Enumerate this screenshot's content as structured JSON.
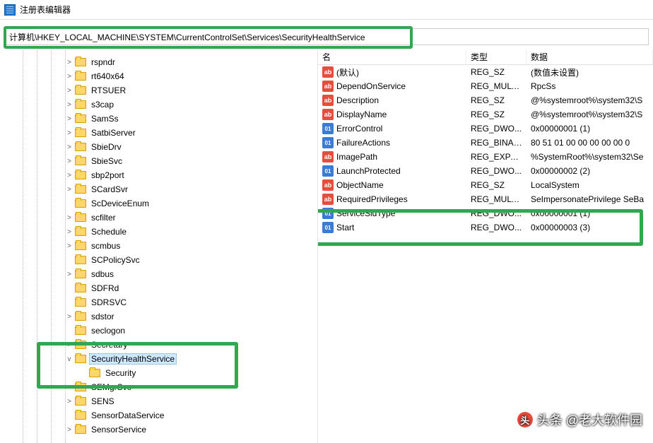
{
  "title": "注册表编辑器",
  "address": "计算机\\HKEY_LOCAL_MACHINE\\SYSTEM\\CurrentControlSet\\Services\\SecurityHealthService",
  "columns": {
    "name": "名",
    "type": "类型",
    "data": "数据"
  },
  "tree": [
    {
      "label": "rspndr",
      "indent": 92,
      "toggle": ">"
    },
    {
      "label": "rt640x64",
      "indent": 92,
      "toggle": ">"
    },
    {
      "label": "RTSUER",
      "indent": 92,
      "toggle": ">"
    },
    {
      "label": "s3cap",
      "indent": 92,
      "toggle": ">"
    },
    {
      "label": "SamSs",
      "indent": 92,
      "toggle": ">"
    },
    {
      "label": "SatbiServer",
      "indent": 92,
      "toggle": ">"
    },
    {
      "label": "SbieDrv",
      "indent": 92,
      "toggle": ">"
    },
    {
      "label": "SbieSvc",
      "indent": 92,
      "toggle": ">"
    },
    {
      "label": "sbp2port",
      "indent": 92,
      "toggle": ">"
    },
    {
      "label": "SCardSvr",
      "indent": 92,
      "toggle": ">"
    },
    {
      "label": "ScDeviceEnum",
      "indent": 92,
      "toggle": " "
    },
    {
      "label": "scfilter",
      "indent": 92,
      "toggle": ">"
    },
    {
      "label": "Schedule",
      "indent": 92,
      "toggle": ">"
    },
    {
      "label": "scmbus",
      "indent": 92,
      "toggle": ">"
    },
    {
      "label": "SCPolicySvc",
      "indent": 92,
      "toggle": " "
    },
    {
      "label": "sdbus",
      "indent": 92,
      "toggle": ">"
    },
    {
      "label": "SDFRd",
      "indent": 92,
      "toggle": " "
    },
    {
      "label": "SDRSVC",
      "indent": 92,
      "toggle": " "
    },
    {
      "label": "sdstor",
      "indent": 92,
      "toggle": ">"
    },
    {
      "label": "seclogon",
      "indent": 92,
      "toggle": " "
    },
    {
      "label": "Secretary",
      "indent": 92,
      "toggle": ">"
    },
    {
      "label": "SecurityHealthService",
      "indent": 92,
      "toggle": "v",
      "selected": true
    },
    {
      "label": "Security",
      "indent": 112,
      "toggle": " "
    },
    {
      "label": "SEMgrSvc",
      "indent": 92,
      "toggle": ">"
    },
    {
      "label": "SENS",
      "indent": 92,
      "toggle": ">"
    },
    {
      "label": "SensorDataService",
      "indent": 92,
      "toggle": " "
    },
    {
      "label": "SensorService",
      "indent": 92,
      "toggle": ">"
    }
  ],
  "values": [
    {
      "icon": "str",
      "name": "(默认)",
      "type": "REG_SZ",
      "data": "(数值未设置)"
    },
    {
      "icon": "str",
      "name": "DependOnService",
      "type": "REG_MULT...",
      "data": "RpcSs"
    },
    {
      "icon": "str",
      "name": "Description",
      "type": "REG_SZ",
      "data": "@%systemroot%\\system32\\S"
    },
    {
      "icon": "str",
      "name": "DisplayName",
      "type": "REG_SZ",
      "data": "@%systemroot%\\system32\\S"
    },
    {
      "icon": "bin",
      "name": "ErrorControl",
      "type": "REG_DWO...",
      "data": "0x00000001 (1)"
    },
    {
      "icon": "bin",
      "name": "FailureActions",
      "type": "REG_BINARY",
      "data": "80 51 01 00 00 00 00 00 0"
    },
    {
      "icon": "str",
      "name": "ImagePath",
      "type": "REG_EXPA...",
      "data": "%SystemRoot%\\system32\\Se"
    },
    {
      "icon": "bin",
      "name": "LaunchProtected",
      "type": "REG_DWO...",
      "data": "0x00000002 (2)"
    },
    {
      "icon": "str",
      "name": "ObjectName",
      "type": "REG_SZ",
      "data": "LocalSystem"
    },
    {
      "icon": "str",
      "name": "RequiredPrivileges",
      "type": "REG_MULT...",
      "data": "SeImpersonatePrivilege SeBa"
    },
    {
      "icon": "bin",
      "name": "ServiceSidType",
      "type": "REG_DWO...",
      "data": "0x00000001 (1)"
    },
    {
      "icon": "bin",
      "name": "Start",
      "type": "REG_DWO...",
      "data": "0x00000003 (3)"
    }
  ],
  "watermark": "头条 @老大软件园"
}
